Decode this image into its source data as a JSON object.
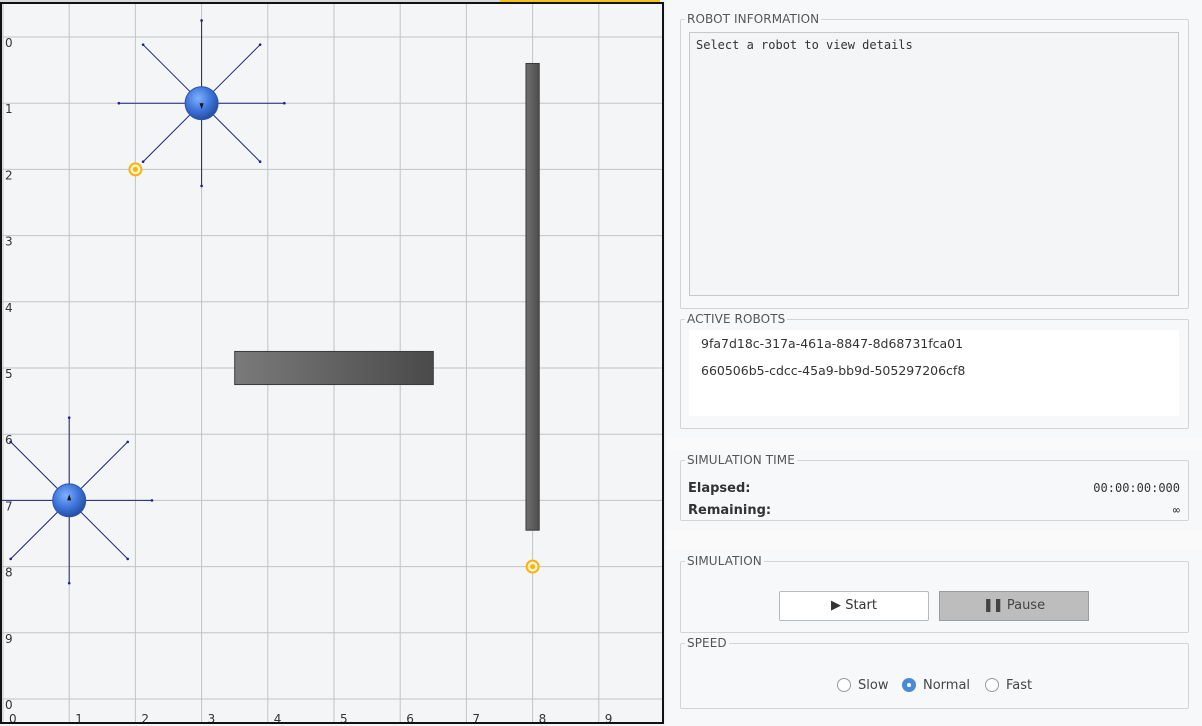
{
  "arena": {
    "grid_size": 10,
    "row_labels": [
      "0",
      "1",
      "2",
      "3",
      "4",
      "5",
      "6",
      "7",
      "8",
      "9",
      "0"
    ],
    "col_labels": [
      "0",
      "1",
      "2",
      "3",
      "4",
      "5",
      "6",
      "7",
      "8",
      "9"
    ],
    "robots": [
      {
        "x": 3,
        "y": 1,
        "heading": "south",
        "sensor_directions": 8
      },
      {
        "x": 1,
        "y": 7,
        "heading": "north",
        "sensor_directions": 8
      }
    ],
    "obstacles": [
      {
        "x1": 3.5,
        "y1": 4.75,
        "x2": 6.5,
        "y2": 5.25
      },
      {
        "x1": 7.9,
        "y1": 0.4,
        "x2": 8.1,
        "y2": 7.45
      }
    ],
    "targets": [
      {
        "x": 2,
        "y": 2
      },
      {
        "x": 8,
        "y": 8
      }
    ],
    "colors": {
      "robot_fill": "#3d73d9",
      "sensor_line": "#1a237e",
      "target": "#f5b316",
      "obstacle": "#5f5f5f",
      "grid": "#c4c4c4"
    }
  },
  "robot_info": {
    "title": "ROBOT INFORMATION",
    "placeholder": "Select a robot to view details"
  },
  "active_robots": {
    "title": "ACTIVE ROBOTS",
    "items": [
      "9fa7d18c-317a-461a-8847-8d68731fca01",
      "660506b5-cdcc-45a9-bb9d-505297206cf8"
    ]
  },
  "simulation_time": {
    "title": "SIMULATION TIME",
    "elapsed_label": "Elapsed:",
    "elapsed_value": "00:00:00:000",
    "remaining_label": "Remaining:",
    "remaining_value": "∞"
  },
  "simulation": {
    "title": "SIMULATION",
    "start_icon": "play-icon",
    "start_label": "Start",
    "pause_icon": "pause-icon",
    "pause_label": "Pause"
  },
  "speed": {
    "title": "SPEED",
    "options": [
      "Slow",
      "Normal",
      "Fast"
    ],
    "selected": "Normal"
  }
}
